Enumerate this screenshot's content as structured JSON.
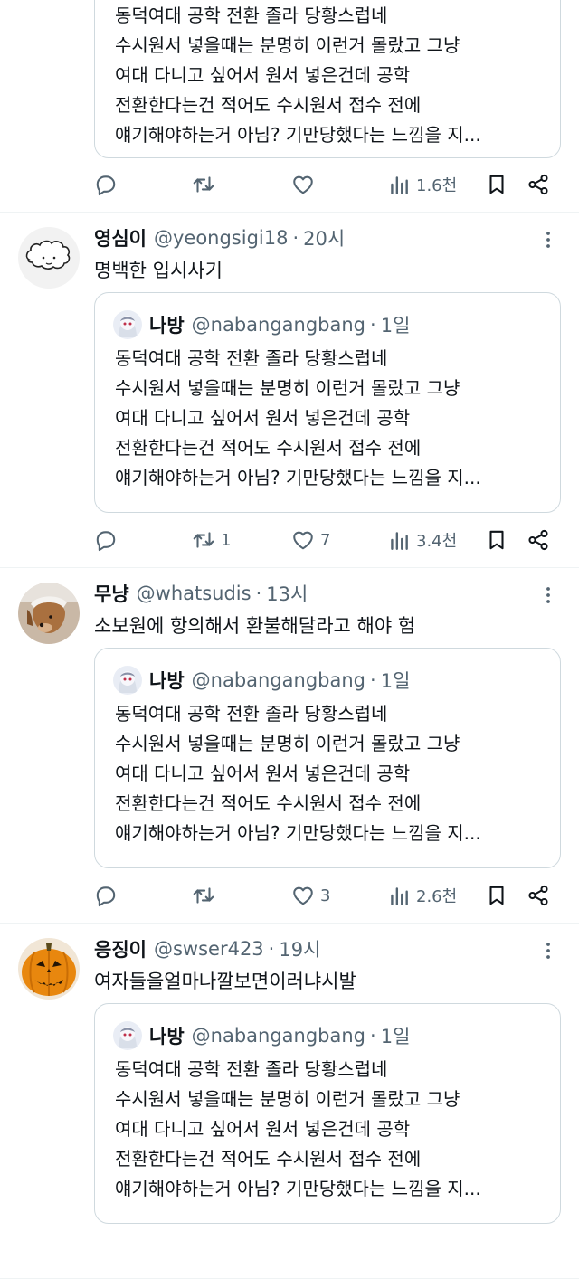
{
  "top_quote": {
    "lines": [
      "동덕여대 공학 전환 졸라 당황스럽네",
      "수시원서 넣을때는 분명히 이런거 몰랐고 그냥",
      "여대 다니고 싶어서 원서 넣은건데 공학",
      "전환한다는건 적어도 수시원서 접수 전에",
      "얘기해야하는거 아님? 기만당했다는 느낌을 지..."
    ]
  },
  "top_actions": {
    "reply": "",
    "retweet": "",
    "like": "",
    "views": "1.6천"
  },
  "replies": [
    {
      "name": "영심이",
      "handle": "@yeongsigi18",
      "time": "20시",
      "text": "명백한 입시사기",
      "avatar_icon": "cartoon-cloud-avatar",
      "quote": {
        "name": "나방",
        "handle": "@nabangangbang",
        "time": "1일",
        "lines": [
          "동덕여대 공학 전환 졸라 당황스럽네",
          "수시원서 넣을때는 분명히 이런거 몰랐고 그냥",
          "여대 다니고 싶어서 원서 넣은건데 공학",
          "전환한다는건 적어도 수시원서 접수 전에",
          "얘기해야하는거 아님? 기만당했다는 느낌을 지..."
        ]
      },
      "actions": {
        "reply": "",
        "retweet": "1",
        "like": "7",
        "views": "3.4천"
      }
    },
    {
      "name": "무냥",
      "handle": "@whatsudis",
      "time": "13시",
      "text": "소보원에 항의해서 환불해달라고 해야 험",
      "avatar_icon": "dog-photo-avatar",
      "quote": {
        "name": "나방",
        "handle": "@nabangangbang",
        "time": "1일",
        "lines": [
          "동덕여대 공학 전환 졸라 당황스럽네",
          "수시원서 넣을때는 분명히 이런거 몰랐고 그냥",
          "여대 다니고 싶어서 원서 넣은건데 공학",
          "전환한다는건 적어도 수시원서 접수 전에",
          "얘기해야하는거 아님? 기만당했다는 느낌을 지..."
        ]
      },
      "actions": {
        "reply": "",
        "retweet": "",
        "like": "3",
        "views": "2.6천"
      }
    },
    {
      "name": "응징이",
      "handle": "@swser423",
      "time": "19시",
      "text": "여자들을얼마나깔보면이러냐시발",
      "avatar_icon": "pumpkin-avatar",
      "quote": {
        "name": "나방",
        "handle": "@nabangangbang",
        "time": "1일",
        "lines": [
          "동덕여대 공학 전환 졸라 당황스럽네",
          "수시원서 넣을때는 분명히 이런거 몰랐고 그냥",
          "여대 다니고 싶어서 원서 넣은건데 공학",
          "전환한다는건 적어도 수시원서 접수 전에",
          "얘기해야하는거 아님? 기만당했다는 느낌을 지..."
        ]
      },
      "actions": {
        "reply": "",
        "retweet": "",
        "like": "",
        "views": ""
      }
    }
  ],
  "colors": {
    "text": "#0f1419",
    "secondary": "#536471",
    "border": "#cfd9de",
    "divider": "#eff3f4"
  }
}
